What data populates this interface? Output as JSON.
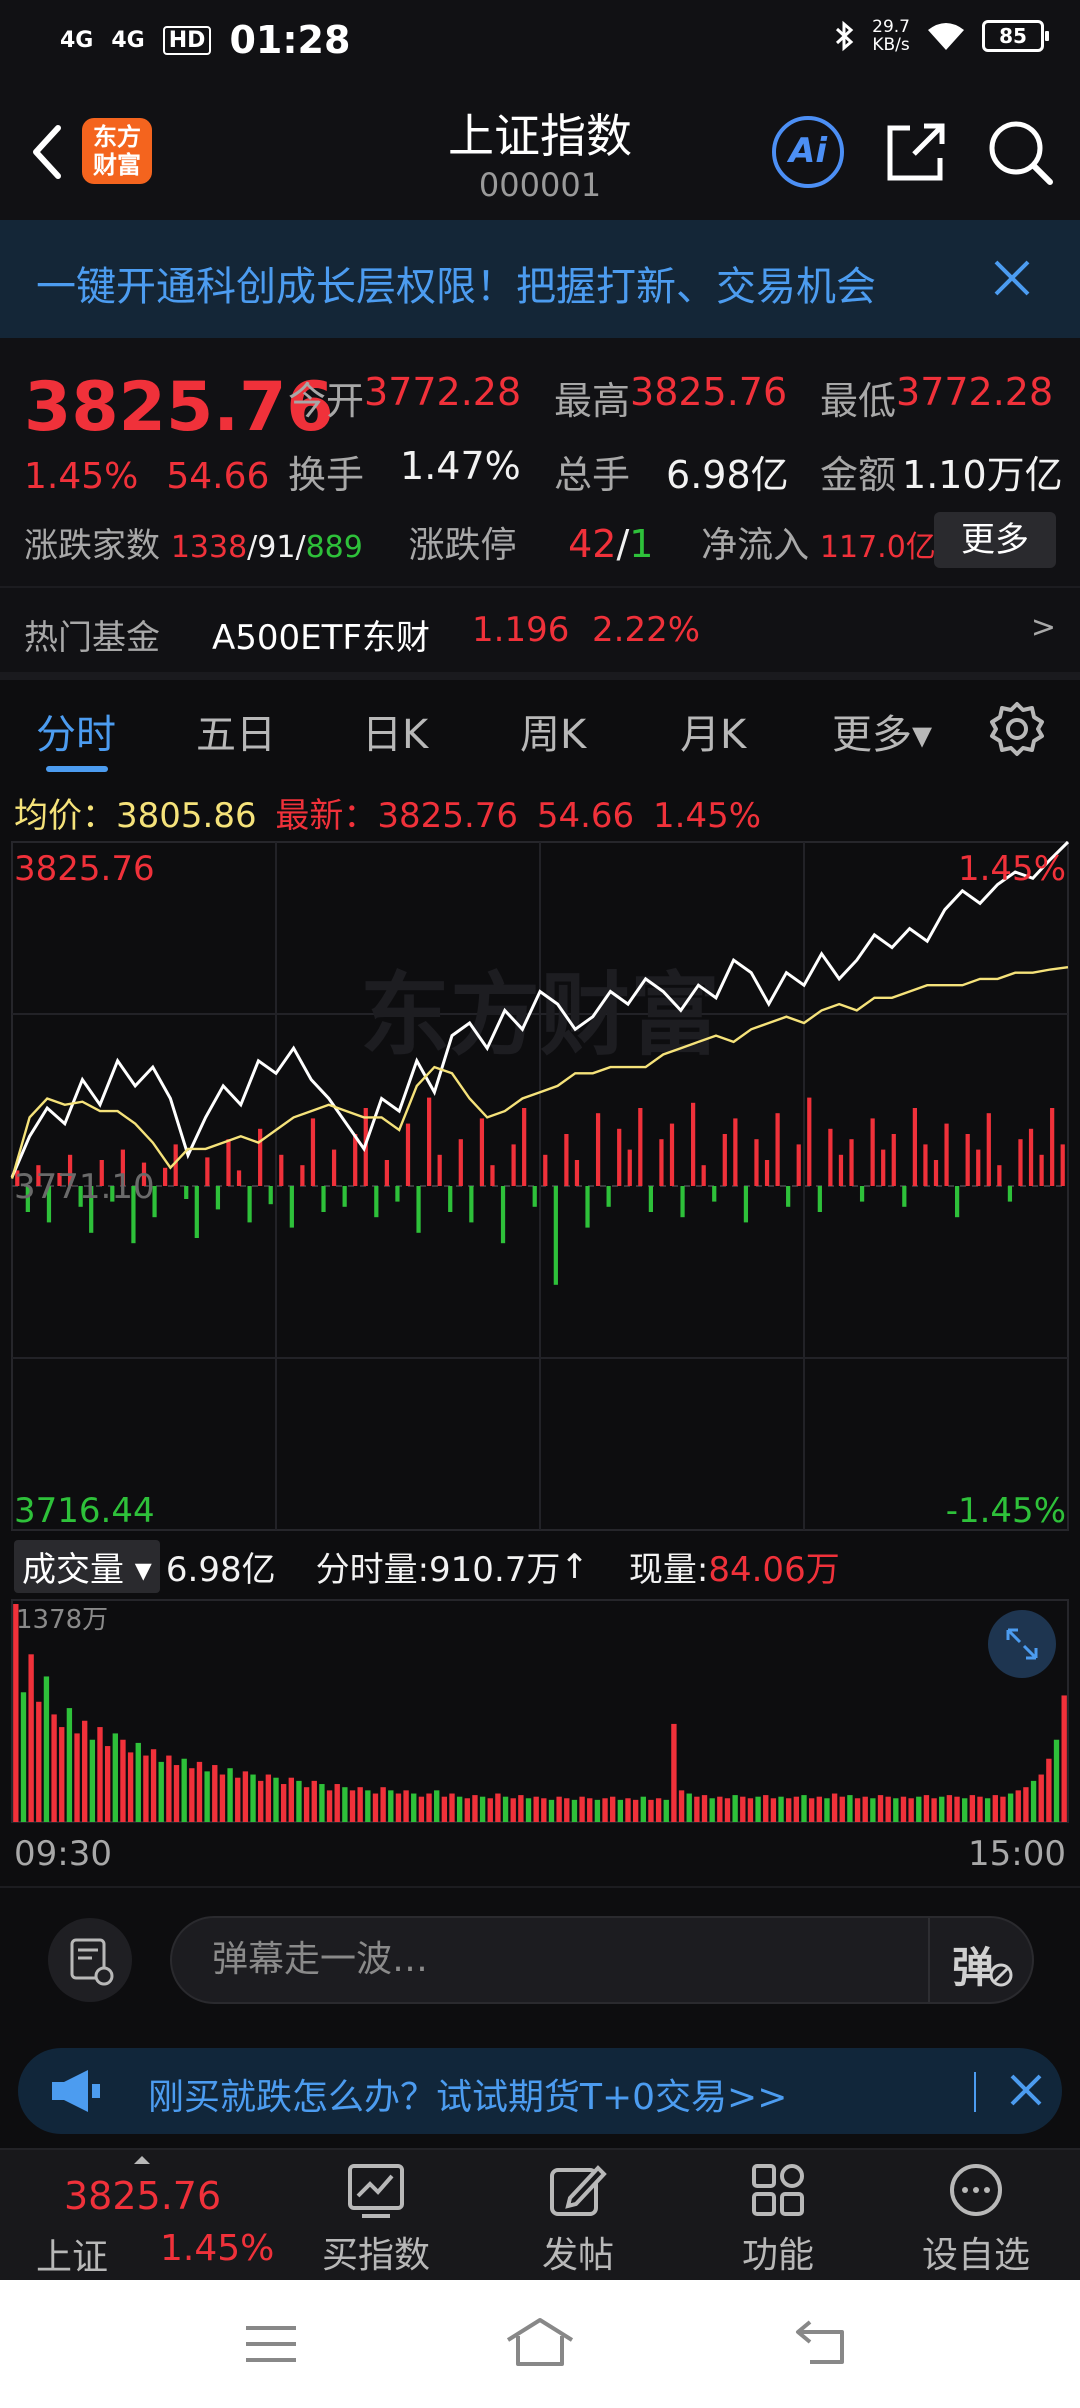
{
  "status_bar": {
    "signal1": "4G",
    "signal2": "4G",
    "hd": "HD",
    "time": "01:28",
    "speed_value": "29.7",
    "speed_unit": "KB/s",
    "battery": "85"
  },
  "header": {
    "logo": "东方财富",
    "title": "上证指数",
    "code": "000001"
  },
  "banner": {
    "text": "一键开通科创成长层权限！把握打新、交易机会"
  },
  "quote": {
    "price": "3825.76",
    "pct": "1.45%",
    "chg": "54.66",
    "open_label": "今开",
    "open": "3772.28",
    "high_label": "最高",
    "high": "3825.76",
    "low_label": "最低",
    "low": "3772.28",
    "turnover_label": "换手",
    "turnover": "1.47%",
    "volume_label": "总手",
    "volume": "6.98亿",
    "amount_label": "金额",
    "amount": "1.10万亿",
    "breadth_label": "涨跌家数",
    "up": "1338",
    "flat": "91",
    "down": "889",
    "limit_label": "涨跌停",
    "limit_up": "42",
    "limit_down": "1",
    "inflow_label": "净流入",
    "inflow": "117.0亿",
    "more_button": "更多"
  },
  "fund": {
    "label": "热门基金",
    "name": "A500ETF东财",
    "price": "1.196",
    "pct": "2.22%",
    "arrow": ">"
  },
  "tabs": [
    {
      "label": "分时",
      "active": true
    },
    {
      "label": "五日"
    },
    {
      "label": "日K"
    },
    {
      "label": "周K"
    },
    {
      "label": "月K"
    },
    {
      "label": "更多▾"
    }
  ],
  "chart_info": {
    "avg_label": "均价：",
    "avg": "3805.86",
    "latest_label": "最新：",
    "latest": "3825.76",
    "chg": "54.66",
    "pct": "1.45%"
  },
  "chart_data": {
    "type": "line",
    "y_top_label": "3825.76",
    "y_mid_label": "3771.10",
    "y_bottom_label": "3716.44",
    "pct_top_label": "1.45%",
    "pct_bottom_label": "-1.45%",
    "ylim": [
      3716.44,
      3825.76
    ],
    "watermark": "东方财富",
    "series": [
      {
        "values": [
          3772.5,
          3779,
          3783.5,
          3781,
          3788,
          3784,
          3791,
          3787,
          3790,
          3785,
          3776,
          3782,
          3787,
          3784,
          3791,
          3789,
          3793,
          3788,
          3785,
          3781,
          3777,
          3785,
          3783,
          3791,
          3786,
          3795,
          3797,
          3793,
          3799,
          3796,
          3802,
          3800,
          3796,
          3798,
          3802,
          3800,
          3804,
          3802,
          3799,
          3803,
          3801,
          3807,
          3805,
          3800,
          3805,
          3803,
          3808,
          3804,
          3807,
          3811,
          3809,
          3812,
          3810,
          3815,
          3818,
          3816,
          3819,
          3821,
          3820,
          3823,
          3825.76
        ]
      },
      {
        "values": [
          3772.28,
          3782,
          3785,
          3784,
          3784.5,
          3783,
          3783,
          3781,
          3778,
          3774,
          3777,
          3777,
          3778,
          3779,
          3778,
          3780,
          3782,
          3783,
          3784,
          3783,
          3782,
          3782,
          3780,
          3787,
          3790,
          3789,
          3785,
          3782,
          3783,
          3785,
          3786,
          3787,
          3789,
          3789,
          3790,
          3790,
          3790,
          3792,
          3793,
          3794,
          3795,
          3794,
          3796,
          3797,
          3798,
          3797,
          3799,
          3800,
          3799,
          3801,
          3801,
          3802,
          3803,
          3803,
          3803,
          3804,
          3804,
          3805,
          3805,
          3805.5,
          3805.86
        ]
      }
    ],
    "flow_bars": [
      6,
      -10,
      8,
      -14,
      5,
      12,
      -8,
      -18,
      10,
      -6,
      14,
      -22,
      9,
      -12,
      7,
      16,
      -5,
      -20,
      11,
      -9,
      18,
      6,
      -14,
      22,
      -7,
      12,
      -16,
      8,
      26,
      -10,
      14,
      -8,
      20,
      30,
      -12,
      10,
      -6,
      24,
      -18,
      34,
      12,
      -10,
      18,
      -14,
      26,
      8,
      -22,
      16,
      30,
      -8,
      12,
      -38,
      20,
      10,
      -16,
      28,
      -8,
      22,
      14,
      30,
      -10,
      18,
      24,
      -12,
      32,
      8,
      -6,
      20,
      26,
      -14,
      18,
      10,
      28,
      -8,
      16,
      34,
      -10,
      22,
      12,
      18,
      -6,
      26,
      14,
      20,
      -8,
      30,
      16,
      10,
      24,
      -12,
      20,
      14,
      28,
      8,
      -6,
      18,
      22,
      12,
      30,
      16
    ],
    "volume_label": "成交量",
    "volume_total": "6.98亿",
    "minute_volume_label": "分时量:",
    "minute_volume": "910.7万",
    "current_volume_label": "现量:",
    "current_volume": "84.06万",
    "volume_max_label": "1378万",
    "x_start": "09:30",
    "x_end": "15:00",
    "volume_bars": [
      1378,
      820,
      1060,
      760,
      920,
      680,
      600,
      720,
      560,
      640,
      520,
      600,
      480,
      560,
      520,
      440,
      500,
      420,
      460,
      380,
      420,
      360,
      400,
      340,
      380,
      320,
      360,
      300,
      340,
      280,
      320,
      300,
      260,
      300,
      280,
      240,
      280,
      260,
      220,
      260,
      240,
      200,
      240,
      220,
      200,
      220,
      200,
      180,
      220,
      200,
      180,
      200,
      180,
      160,
      180,
      200,
      160,
      180,
      160,
      150,
      170,
      160,
      150,
      180,
      160,
      150,
      170,
      150,
      160,
      150,
      140,
      160,
      150,
      140,
      160,
      150,
      140,
      150,
      160,
      140,
      150,
      140,
      160,
      140,
      150,
      140,
      620,
      200,
      180,
      160,
      170,
      150,
      160,
      150,
      170,
      160,
      150,
      160,
      170,
      150,
      160,
      150,
      160,
      170,
      150,
      160,
      150,
      180,
      160,
      170,
      150,
      160,
      150,
      170,
      160,
      150,
      160,
      150,
      160,
      170,
      150,
      160,
      170,
      160,
      150,
      170,
      160,
      150,
      170,
      160,
      180,
      200,
      220,
      260,
      300,
      400,
      520,
      800
    ]
  },
  "danmaku": {
    "placeholder": "弹幕走一波…",
    "send_button": "弹"
  },
  "promo": {
    "text": "刚买就跌怎么办？试试期货T+0交易>>"
  },
  "bottom_nav": {
    "index_price": "3825.76",
    "index_name": "上证",
    "index_pct": "1.45%",
    "items": [
      {
        "label": "买指数"
      },
      {
        "label": "发帖"
      },
      {
        "label": "功能"
      },
      {
        "label": "设自选"
      }
    ]
  },
  "colors": {
    "up": "#f0313a",
    "down": "#2ec13a",
    "accent": "#4c9cf0",
    "avg_line": "#f5e27a"
  }
}
